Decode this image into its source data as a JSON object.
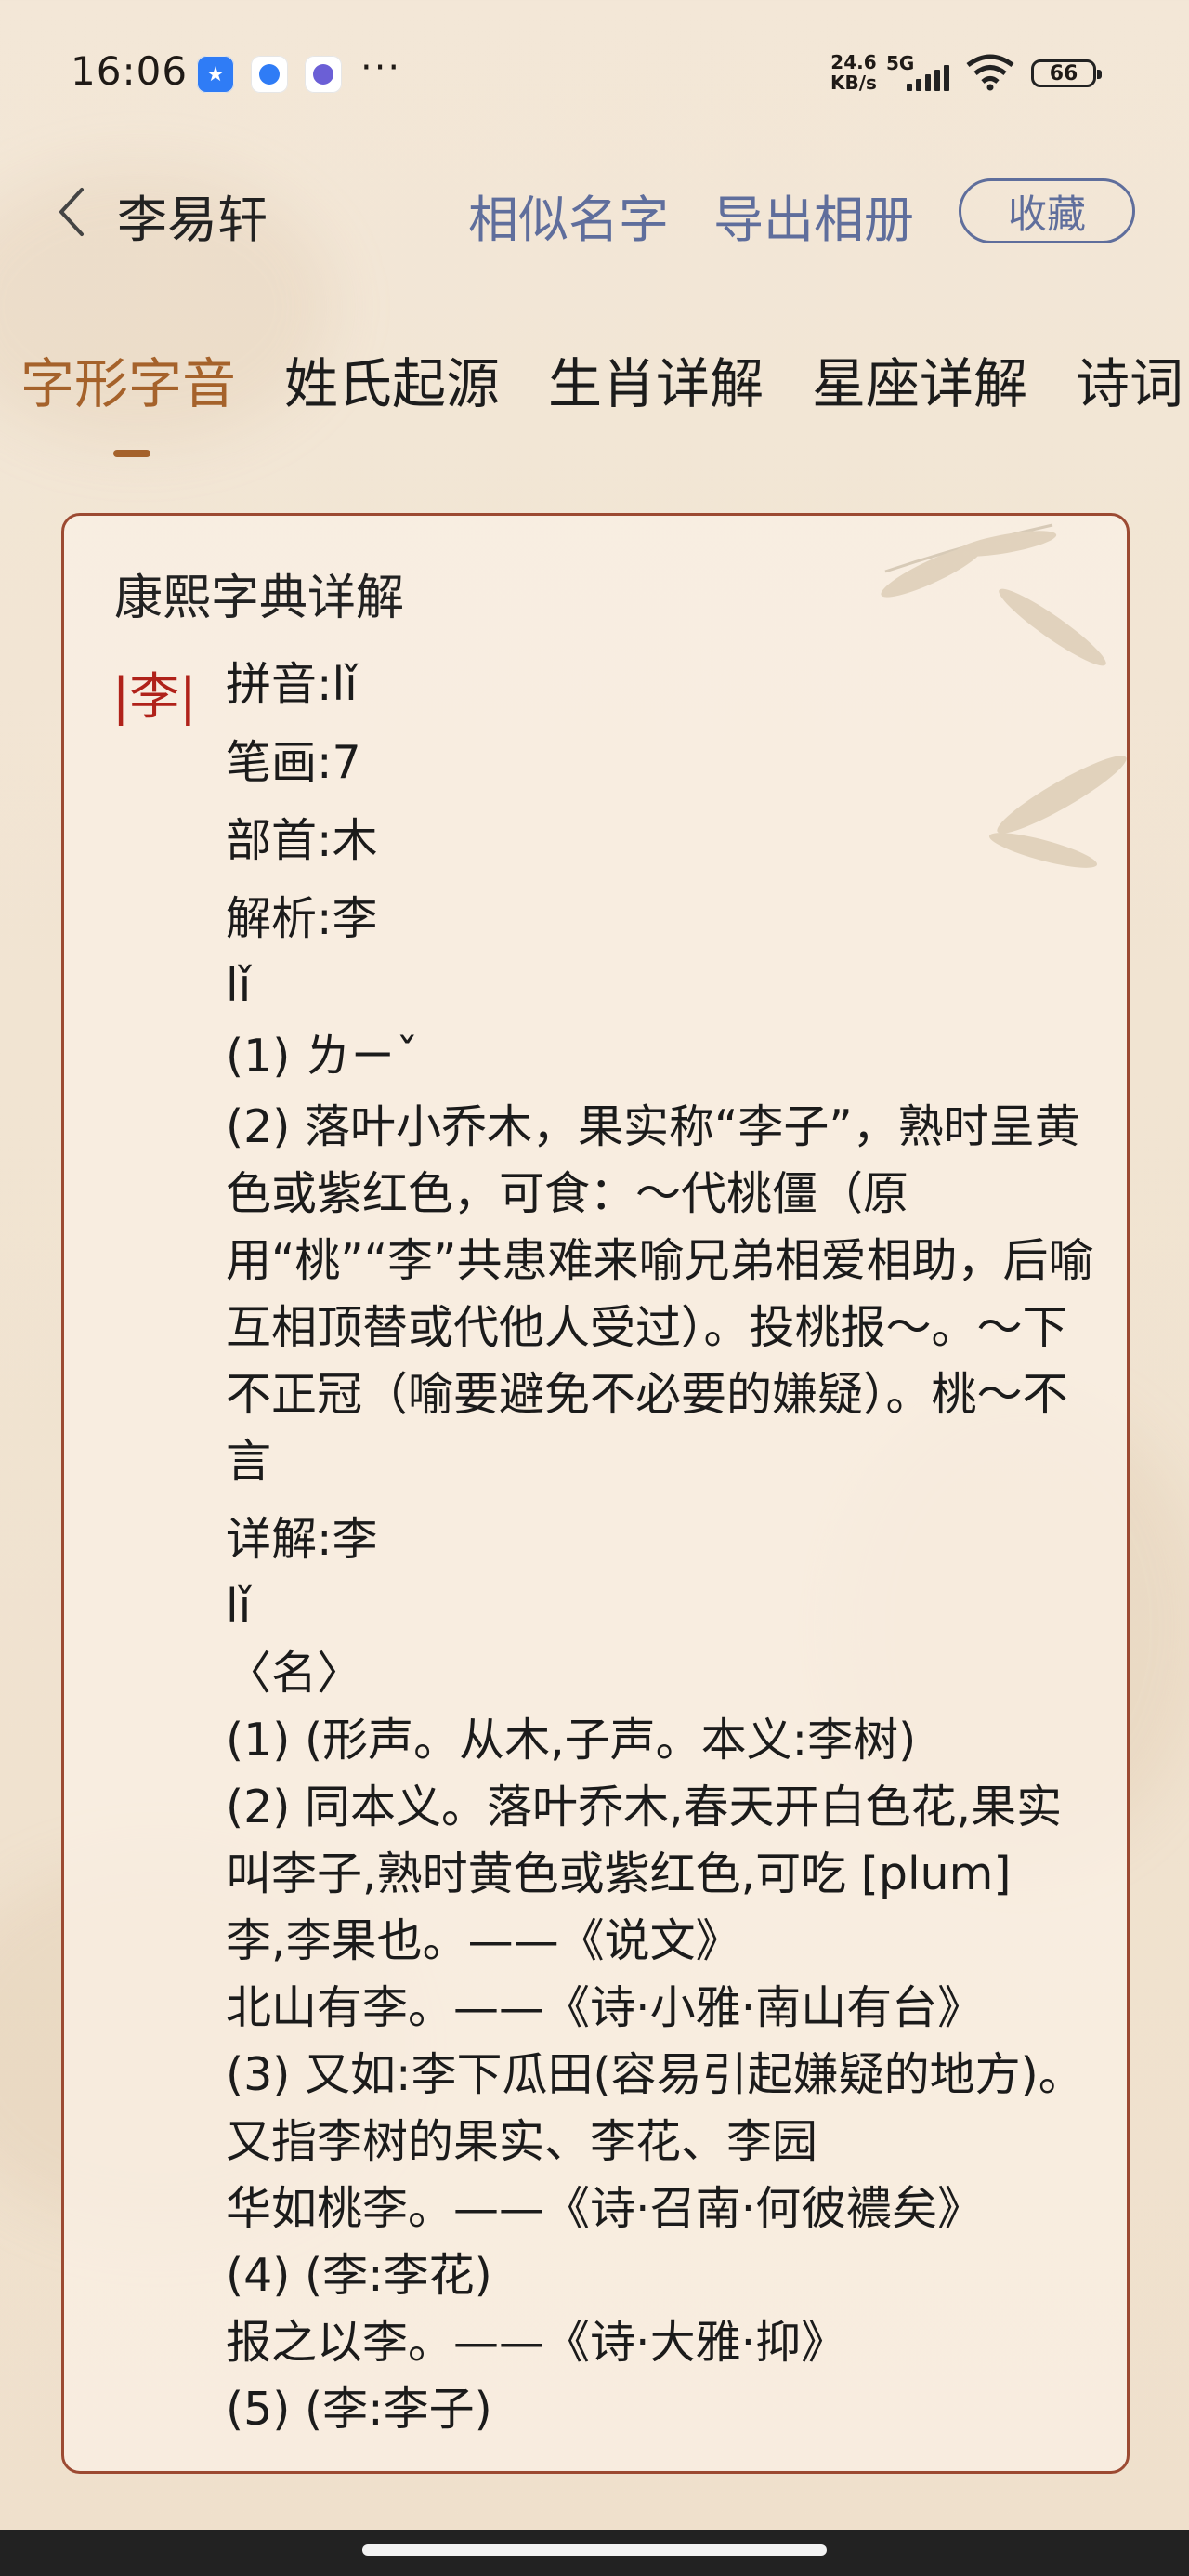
{
  "status_bar": {
    "time": "16:06",
    "more": "···",
    "speed_value": "24.6",
    "speed_unit": "KB/s",
    "network": "5G",
    "battery": "66"
  },
  "header": {
    "title": "李易轩",
    "similar_names": "相似名字",
    "export_album": "导出相册",
    "favorite": "收藏"
  },
  "tabs": [
    {
      "label": "字形字音",
      "active": true
    },
    {
      "label": "姓氏起源",
      "active": false
    },
    {
      "label": "生肖详解",
      "active": false
    },
    {
      "label": "星座详解",
      "active": false
    },
    {
      "label": "诗词",
      "active": false
    }
  ],
  "card": {
    "title": "康熙字典详解",
    "char_mark": "|李|",
    "lines": [
      "拼音:lǐ",
      "笔画:7",
      "部首:木",
      "解析:李",
      "lǐ",
      "(1) ㄌㄧˇ",
      "(2) 落叶小乔木，果实称“李子”，熟时呈黄色或紫红色，可食：～代桃僵（原用“桃”“李”共患难来喻兄弟相爱相助，后喻互相顶替或代他人受过）。投桃报～。～下不正冠（喻要避免不必要的嫌疑）。桃～不言",
      "详解:李",
      "lǐ",
      "〈名〉",
      "(1) (形声。从木,子声。本义:李树)",
      "(2) 同本义。落叶乔木,春天开白色花,果实叫李子,熟时黄色或紫红色,可吃 [plum]",
      "李,李果也。——《说文》",
      "北山有李。——《诗·小雅·南山有台》",
      "(3) 又如:李下瓜田(容易引起嫌疑的地方)。又指李树的果实、李花、李园",
      "华如桃李。——《诗·召南·何彼襛矣》",
      "(4) (李:李花)",
      "报之以李。——《诗·大雅·抑》",
      "(5) (李:李子)"
    ]
  },
  "colors": {
    "accent": "#a5622b",
    "link": "#5f6e9c",
    "card_border": "#9c4a32",
    "char_mark": "#b0221a"
  }
}
